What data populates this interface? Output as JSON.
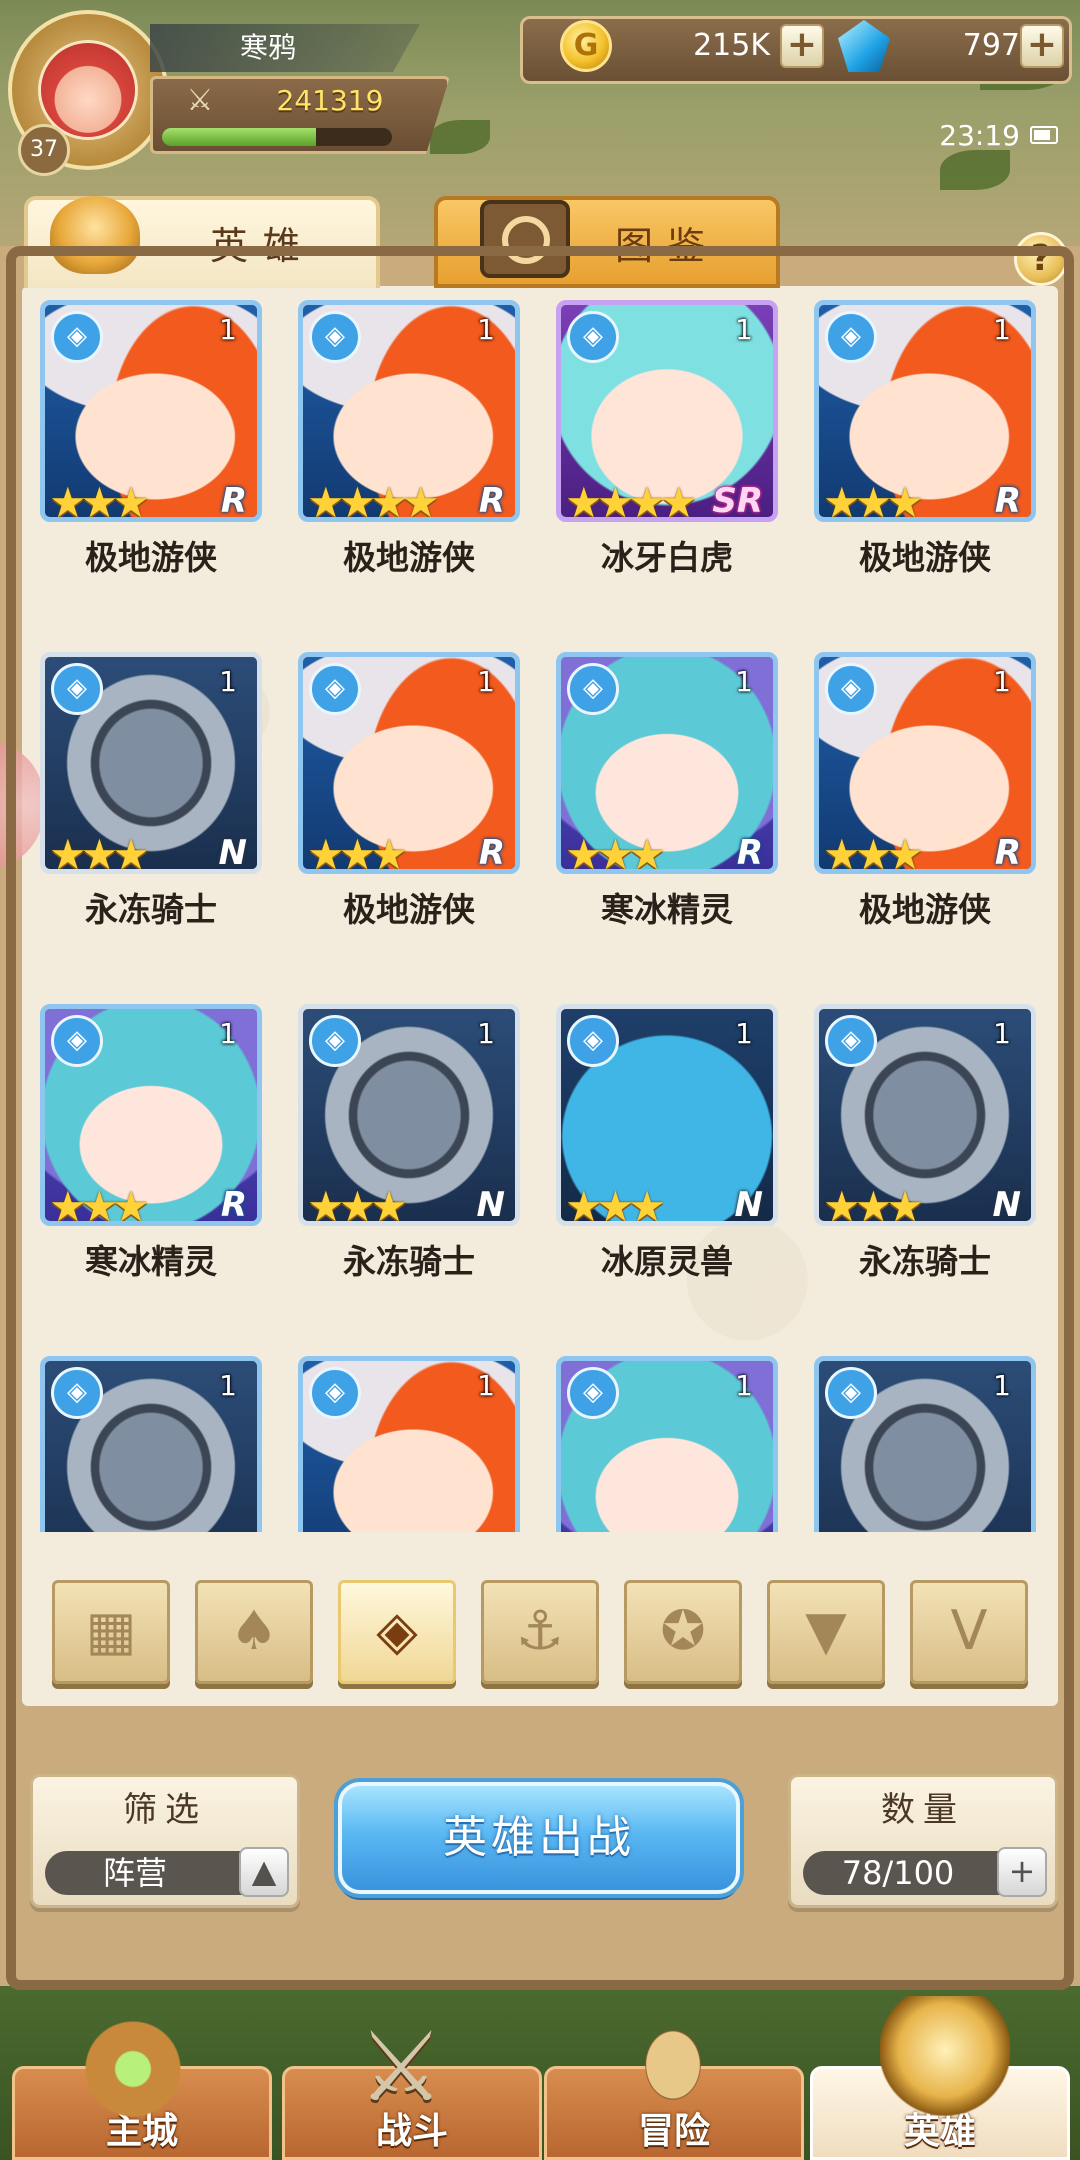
{
  "player": {
    "name": "寒鸦",
    "level": "37",
    "power": "241319",
    "exp_progress": 0.67
  },
  "currency": {
    "coins": "215K",
    "coin_symbol": "G",
    "gems": "797",
    "plus": "+"
  },
  "status": {
    "time": "23:19"
  },
  "tabs": [
    {
      "label": "英雄",
      "active": true
    },
    {
      "label": "图鉴",
      "active": false
    }
  ],
  "help_label": "?",
  "heroes": [
    {
      "name": "极地游侠",
      "level": "1",
      "stars": "★★★",
      "rarity": "R",
      "art": "ranger"
    },
    {
      "name": "极地游侠",
      "level": "1",
      "stars": "★★★★",
      "rarity": "R",
      "art": "ranger"
    },
    {
      "name": "冰牙白虎",
      "level": "1",
      "stars": "★★★★",
      "rarity": "SR",
      "art": "tiger"
    },
    {
      "name": "极地游侠",
      "level": "1",
      "stars": "★★★",
      "rarity": "R",
      "art": "ranger"
    },
    {
      "name": "永冻骑士",
      "level": "1",
      "stars": "★★★",
      "rarity": "N",
      "art": "knight"
    },
    {
      "name": "极地游侠",
      "level": "1",
      "stars": "★★★",
      "rarity": "R",
      "art": "ranger"
    },
    {
      "name": "寒冰精灵",
      "level": "1",
      "stars": "★★★",
      "rarity": "R",
      "art": "spirit"
    },
    {
      "name": "极地游侠",
      "level": "1",
      "stars": "★★★",
      "rarity": "R",
      "art": "ranger"
    },
    {
      "name": "寒冰精灵",
      "level": "1",
      "stars": "★★★",
      "rarity": "R",
      "art": "spirit"
    },
    {
      "name": "永冻骑士",
      "level": "1",
      "stars": "★★★",
      "rarity": "N",
      "art": "knight"
    },
    {
      "name": "冰原灵兽",
      "level": "1",
      "stars": "★★★",
      "rarity": "N",
      "art": "beast"
    },
    {
      "name": "永冻骑士",
      "level": "1",
      "stars": "★★★",
      "rarity": "N",
      "art": "knight"
    },
    {
      "name": "",
      "level": "1",
      "stars": "",
      "rarity": "",
      "art": "knight"
    },
    {
      "name": "",
      "level": "1",
      "stars": "",
      "rarity": "",
      "art": "ranger"
    },
    {
      "name": "",
      "level": "1",
      "stars": "",
      "rarity": "",
      "art": "spirit"
    },
    {
      "name": "",
      "level": "1",
      "stars": "",
      "rarity": "",
      "art": "knight"
    }
  ],
  "faction_filters": [
    {
      "icon": "grid-icon",
      "glyph": "▦",
      "active": false
    },
    {
      "icon": "leaf-crest-icon",
      "glyph": "♠",
      "active": false
    },
    {
      "icon": "ice-crest-icon",
      "glyph": "◈",
      "active": true
    },
    {
      "icon": "anchor-icon",
      "glyph": "⚓",
      "active": false
    },
    {
      "icon": "beast-head-icon",
      "glyph": "✪",
      "active": false
    },
    {
      "icon": "demon-crest-icon",
      "glyph": "▼",
      "active": false
    },
    {
      "icon": "wing-crest-icon",
      "glyph": "V",
      "active": false
    }
  ],
  "filter_box": {
    "title": "筛选",
    "value": "阵营",
    "toggle": "▲"
  },
  "deploy_button": "英雄出战",
  "count_box": {
    "title": "数量",
    "value": "78/100",
    "plus": "+"
  },
  "nav": [
    {
      "label": "主城",
      "active": false,
      "icon": "city-icon"
    },
    {
      "label": "战斗",
      "active": false,
      "icon": "battle-icon"
    },
    {
      "label": "冒险",
      "active": false,
      "icon": "adventure-icon"
    },
    {
      "label": "英雄",
      "active": true,
      "icon": "heroes-icon"
    }
  ],
  "colors": {
    "paper": "#f3ecdc",
    "deploy_button": "#5ab8f2",
    "tab_inactive": "#e7a02f",
    "star": "#ffd23a"
  }
}
